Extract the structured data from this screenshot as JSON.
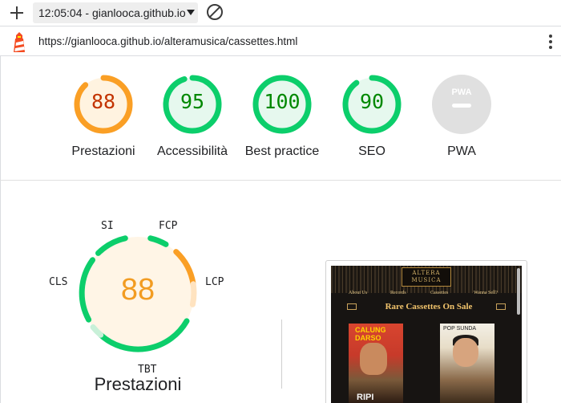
{
  "toolbar": {
    "new_report_icon": "plus-icon",
    "report_selector": "12:05:04 - gianlooca.github.io",
    "clear_icon": "block-icon"
  },
  "urlbar": {
    "logo_icon": "lighthouse-icon",
    "url": "https://gianlooca.github.io/alteramusica/cassettes.html",
    "menu_icon": "kebab-menu-icon"
  },
  "categories": [
    {
      "key": "performance",
      "score": "88",
      "label": "Prestazioni",
      "color": "#fa9f25",
      "bg": "#fff3e0",
      "text_color": "#c33300",
      "fraction": 0.88
    },
    {
      "key": "accessibility",
      "score": "95",
      "label": "Accessibilità",
      "color": "#0cce6b",
      "bg": "#e6f8ee",
      "text_color": "#008800",
      "fraction": 0.95
    },
    {
      "key": "best-practices",
      "score": "100",
      "label": "Best practice",
      "color": "#0cce6b",
      "bg": "#e6f8ee",
      "text_color": "#008800",
      "fraction": 1.0
    },
    {
      "key": "seo",
      "score": "90",
      "label": "SEO",
      "color": "#0cce6b",
      "bg": "#e6f8ee",
      "text_color": "#008800",
      "fraction": 0.9
    },
    {
      "key": "pwa",
      "score": "",
      "label": "PWA",
      "badge": "PWA",
      "color": "#cccccc",
      "bg": "#e0e0e0"
    }
  ],
  "performance_detail": {
    "score": "88",
    "title": "Prestazioni",
    "metrics": [
      "SI",
      "FCP",
      "LCP",
      "TBT",
      "CLS"
    ],
    "colors": {
      "good": "#0cce6b",
      "average": "#fa9f25",
      "average_light": "#ffe3c0",
      "score_bg": "#fff5e6"
    }
  },
  "screenshot": {
    "logo_line1": "ALTERA",
    "logo_line2": "MUSICA",
    "nav": [
      "About Us",
      "Records",
      "Cassettes",
      "Wanna Sell?"
    ],
    "heading": "Rare Cassettes On Sale",
    "tape1_title": "CALUNG DARSO",
    "tape1_bottom": "RIPI",
    "tape2_title": "POP SUNDA"
  }
}
